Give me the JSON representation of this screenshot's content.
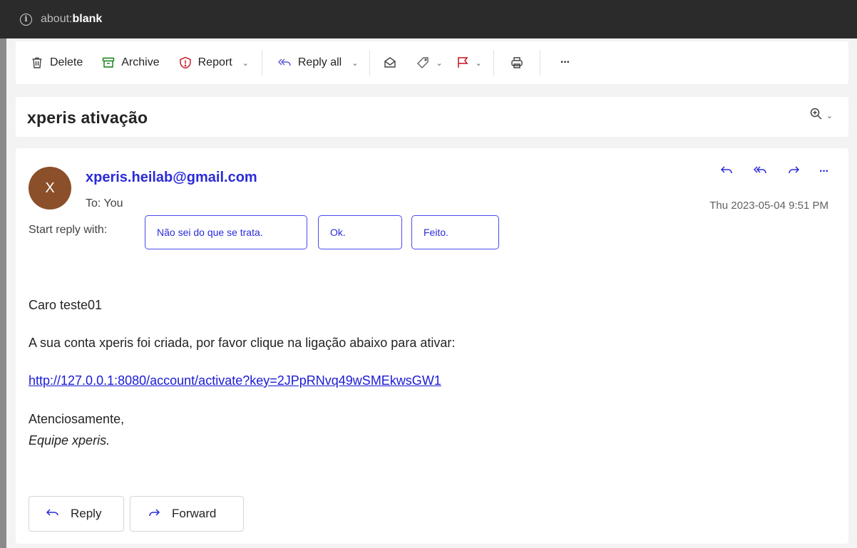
{
  "browser": {
    "url_scheme": "about:",
    "url_host": "blank",
    "info_glyph": "i"
  },
  "toolbar": {
    "delete_label": "Delete",
    "archive_label": "Archive",
    "report_label": "Report",
    "reply_all_label": "Reply all",
    "more_glyph": "···"
  },
  "subject": "xperis ativação",
  "message": {
    "avatar_initial": "X",
    "avatar_color": "#8b4f2a",
    "sender": "xperis.heilab@gmail.com",
    "to": "To: You",
    "date": "Thu 2023-05-04 9:51 PM",
    "more_glyph": "···",
    "start_reply_label": "Start reply with:",
    "suggestions": [
      "Não sei do que se trata.",
      "Ok.",
      "Feito."
    ],
    "body": {
      "greeting": "Caro teste01",
      "line1": "A sua conta xperis foi criada, por favor clique na ligação abaixo para ativar:",
      "link": "http://127.0.0.1:8080/account/activate?key=2JPpRNvq49wSMEkwsGW1",
      "closing": "Atenciosamente,",
      "signature": "Equipe xperis."
    },
    "reply_label": "Reply",
    "forward_label": "Forward"
  },
  "colors": {
    "accent": "#2b2bd9",
    "archive_green": "#107c10",
    "report_red": "#c50f1f",
    "flag_red": "#c50f1f"
  },
  "icons": [
    "info-icon",
    "trash-icon",
    "archive-icon",
    "report-icon",
    "reply-all-icon",
    "envelope-open-icon",
    "tag-icon",
    "flag-icon",
    "print-icon",
    "more-icon",
    "zoom-icon",
    "reply-icon",
    "forward-icon"
  ]
}
